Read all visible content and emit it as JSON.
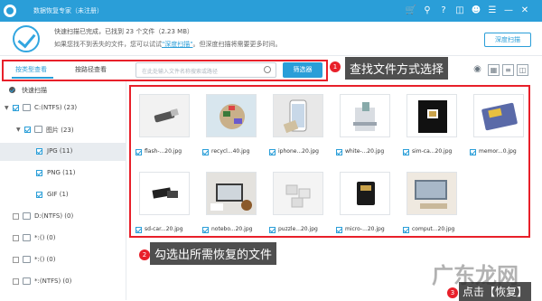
{
  "window": {
    "title": "数据恢复专家（未注册）",
    "controls": [
      "cart-icon",
      "key-icon",
      "help-icon",
      "gift-icon",
      "user-icon",
      "menu-icon",
      "minimize-icon",
      "close-icon"
    ]
  },
  "status": {
    "line1": "快速扫描已完成，已找到 23 个文件（2.23 MB）",
    "line2_prefix": "如果您找不到丢失的文件，您可以试试",
    "line2_link": "\"深度扫描\"",
    "line2_suffix": "。但深度扫描将需要更多时间。",
    "deep_scan_button": "深度扫描"
  },
  "tabs": [
    {
      "label": "按类型查看",
      "active": true
    },
    {
      "label": "按路径查看",
      "active": false
    }
  ],
  "search": {
    "placeholder": "在此处输入文件名称搜索或路径"
  },
  "filter_button": "筛选器",
  "annotations": [
    {
      "number": "1",
      "text": "查找文件方式选择"
    },
    {
      "number": "2",
      "text": "勾选出所需恢复的文件"
    },
    {
      "number": "3",
      "text": "点击【恢复】"
    }
  ],
  "view_icons": [
    "eye-icon",
    "grid-icon",
    "list-icon",
    "details-icon"
  ],
  "tree": [
    {
      "label": "快速扫描",
      "checked": true
    },
    {
      "label": "C:(NTFS) (23)",
      "checked": true
    },
    {
      "label": "图片 (23)",
      "checked": true
    },
    {
      "label": "JPG (11)",
      "checked": true,
      "selected": true
    },
    {
      "label": "PNG (11)",
      "checked": true
    },
    {
      "label": "GIF (1)",
      "checked": true
    },
    {
      "label": "D:(NTFS) (0)",
      "checked": false
    },
    {
      "label": "*:() (0)",
      "checked": false
    },
    {
      "label": "*:() (0)",
      "checked": false
    },
    {
      "label": "*:(NTFS) (0)",
      "checked": false
    }
  ],
  "files": [
    {
      "name": "flash-...20.jpg",
      "checked": true
    },
    {
      "name": "recycl...40.jpg",
      "checked": true
    },
    {
      "name": "iphone...20.jpg",
      "checked": true
    },
    {
      "name": "white-...20.jpg",
      "checked": true
    },
    {
      "name": "sim-ca...20.jpg",
      "checked": true
    },
    {
      "name": "memor...0.jpg",
      "checked": true
    },
    {
      "name": "sd-car...20.jpg",
      "checked": true
    },
    {
      "name": "notebo...20.jpg",
      "checked": true
    },
    {
      "name": "puzzle...20.jpg",
      "checked": true
    },
    {
      "name": "micro-...20.jpg",
      "checked": true
    },
    {
      "name": "comput...20.jpg",
      "checked": true
    }
  ],
  "watermark": "广东龙网",
  "colors": {
    "accent": "#2a9ed8",
    "annotation_red": "#e8202a"
  }
}
